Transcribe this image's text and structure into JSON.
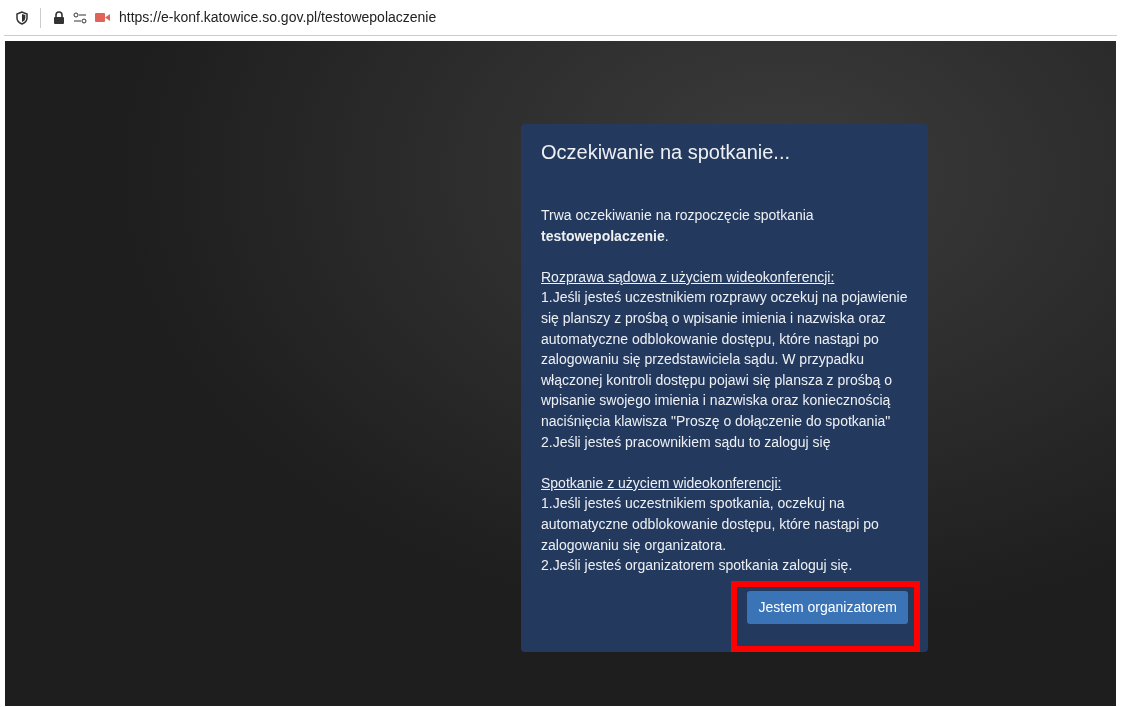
{
  "address_bar": {
    "url": "https://e-konf.katowice.so.gov.pl/testowepolaczenie",
    "camera_active": true
  },
  "dialog": {
    "title": "Oczekiwanie na spotkanie...",
    "intro": "Trwa oczekiwanie na rozpoczęcie spotkania **testowepolaczenie**.",
    "sections": [
      {
        "heading": "Rozprawa sądowa z użyciem wideokonferencji:",
        "items": [
          "1.Jeśli jesteś uczestnikiem rozprawy oczekuj na pojawienie się planszy z prośbą o wpisanie imienia i nazwiska oraz automatyczne odblokowanie dostępu, które nastąpi po zalogowaniu się przedstawiciela sądu. W przypadku włączonej kontroli dostępu pojawi się plansza z prośbą o wpisanie swojego imienia i nazwiska oraz koniecznością naciśnięcia klawisza \"Proszę o dołączenie do spotkania\"",
          "2.Jeśli jesteś pracownikiem sądu to zaloguj się"
        ]
      },
      {
        "heading": "Spotkanie z użyciem wideokonferencji:",
        "items": [
          "1.Jeśli jesteś uczestnikiem spotkania, oczekuj na automatyczne odblokowanie dostępu, które nastąpi po zalogowaniu się organizatora.",
          "2.Jeśli jesteś organizatorem spotkania zaloguj się."
        ]
      }
    ],
    "button": {
      "label": "Jestem organizatorem",
      "highlighted": true
    }
  }
}
